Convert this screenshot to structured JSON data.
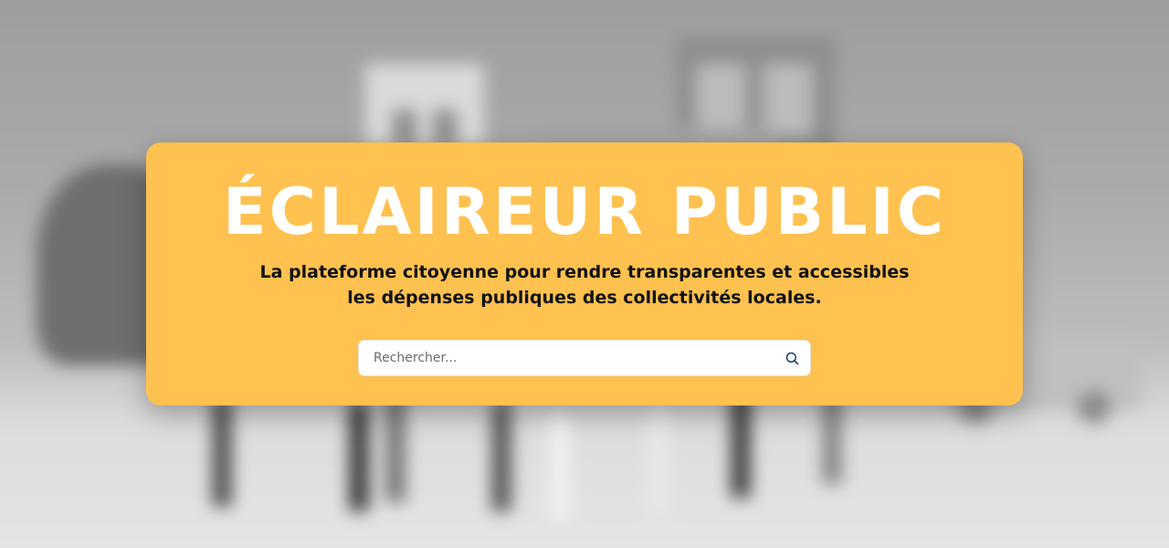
{
  "hero": {
    "title": "ÉCLAIREUR PUBLIC",
    "subtitle": "La plateforme citoyenne pour rendre transparentes et accessibles les dépenses publiques des collectivités locales.",
    "accent_color": "#ffc14f"
  },
  "search": {
    "placeholder": "Rechercher...",
    "value": "",
    "icon": "search-icon"
  }
}
